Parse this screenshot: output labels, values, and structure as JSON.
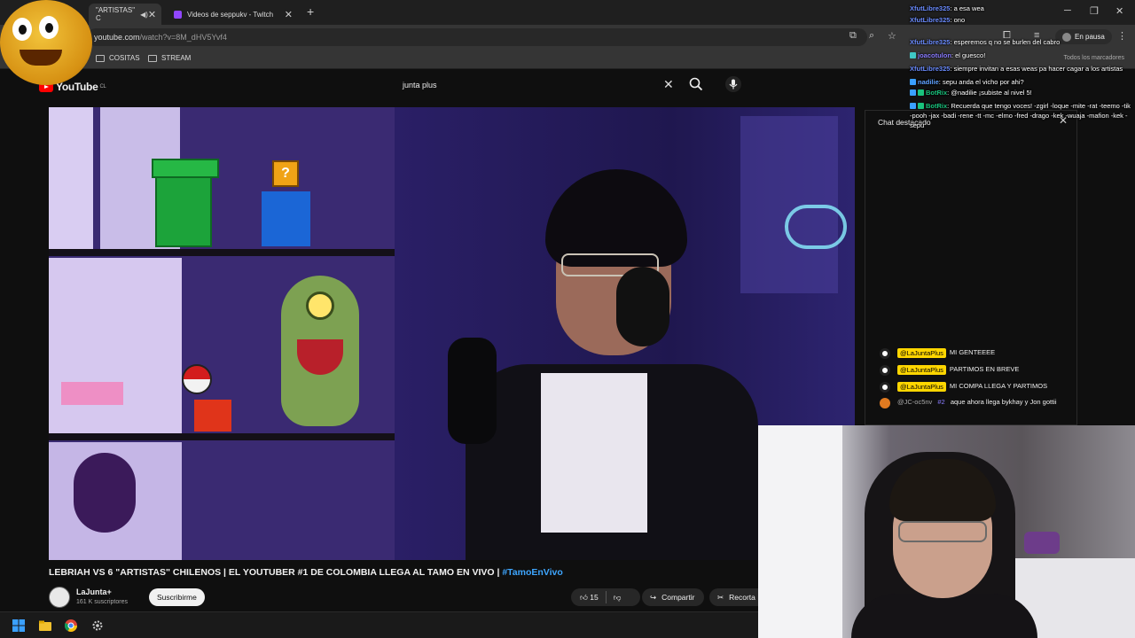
{
  "browser": {
    "tabs": [
      {
        "label": "\"ARTISTAS\" C"
      },
      {
        "label": "Videos de seppukv - Twitch"
      }
    ],
    "url_host": "youtube.com",
    "url_path": "/watch?v=8M_dHV5Yvf4",
    "paused_label": "En pausa",
    "bookmarks": [
      {
        "label": "COSITAS"
      },
      {
        "label": "STREAM"
      }
    ],
    "all_bookmarks": "Todos los marcadores"
  },
  "youtube": {
    "logo": "YouTube",
    "region": "CL",
    "search_value": "junta plus",
    "video_title": "LEBRIAH VS 6 \"ARTISTAS\" CHILENOS | EL YOUTUBER #1 DE COLOMBIA LLEGA AL TAMO EN VIVO | ",
    "video_hashtag": "#TamoEnVivo",
    "channel_name": "LaJunta+",
    "channel_subs": "161 K suscriptores",
    "subscribe_label": "Suscribirme",
    "like_count": "15",
    "share_label": "Compartir",
    "clip_label": "Recorta",
    "livechat": {
      "header": "Chat destacado",
      "messages": [
        {
          "author": "@LaJuntaPlus",
          "owner": true,
          "text": "MI GENTEEEE"
        },
        {
          "author": "@LaJuntaPlus",
          "owner": true,
          "text": "PARTIMOS EN BREVE"
        },
        {
          "author": "@LaJuntaPlus",
          "owner": true,
          "text": "MI COMPA LLEGA Y PARTIMOS"
        },
        {
          "author": "@JC-oc5nv",
          "owner": false,
          "member": "#2",
          "text": "aque ahora llega bykhay y Jon gottii"
        }
      ]
    }
  },
  "twitch_chat": [
    {
      "user": "XfutLibre325",
      "color": "#6b8cff",
      "text": "a esa wea"
    },
    {
      "user": "XfutLibre325",
      "color": "#6b8cff",
      "text": "ono"
    },
    {
      "user": "XfutLibre325",
      "color": "#6b8cff",
      "text": "esperemos q no se burlen del cabro"
    },
    {
      "user": "joacotulon",
      "color": "#8a7cff",
      "text": "el guesco!"
    },
    {
      "user": "XfutLibre325",
      "color": "#6b8cff",
      "text": "siempre invitan a esas weas pa hacer cagar a los artistas"
    },
    {
      "user": "nadilie",
      "color": "#5fa0ff",
      "text": "sepu anda el vicho por ahi?"
    },
    {
      "user": "BotRix",
      "color": "#19c37d",
      "text": "@nadilie ¡subiste al nivel 5!"
    },
    {
      "user": "BotRix",
      "color": "#19c37d",
      "text": "Recuerda que tengo voces! -zgirl -loque -mite -rat -teemo -tik -pooh -jax -badi -rene -tt -mc -elmo -fred -drago -kek -wuaja -mafion -kek -sepu"
    }
  ],
  "colors": {
    "youtube_red": "#ff0000",
    "link_blue": "#3ea6ff",
    "owner_yellow": "#ffd600"
  },
  "icons": [
    "search-icon",
    "mic-icon",
    "like-icon",
    "dislike-icon",
    "share-icon",
    "scissors-icon",
    "windows-start-icon",
    "folder-icon",
    "chrome-icon"
  ]
}
